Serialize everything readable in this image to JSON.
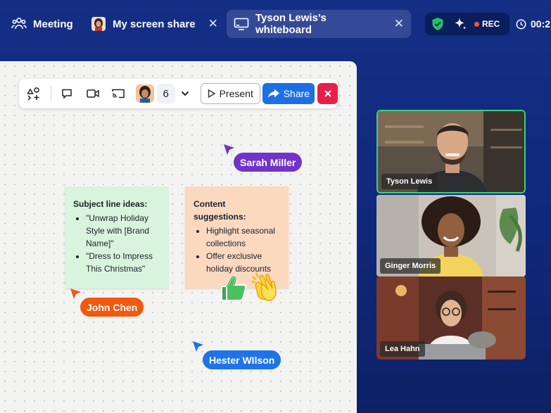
{
  "tabs": {
    "meeting": {
      "label": "Meeting",
      "icon": "people-icon"
    },
    "screen_share": {
      "label": "My screen share",
      "close": "✕"
    },
    "whiteboard": {
      "label": "Tyson Lewis’s whiteboard",
      "close": "✕",
      "active": true
    }
  },
  "status": {
    "rec_label": "REC",
    "timer": "00:2",
    "accent_green": "#22c36b"
  },
  "toolbar": {
    "participant_count": "6",
    "present_label": "Present",
    "share_label": "Share",
    "colors": {
      "share": "#1e6fe6",
      "stop": "#e5214a"
    }
  },
  "notes": [
    {
      "title": "Subject line ideas:",
      "items": [
        "\"Unwrap Holiday Style with [Brand Name]\"",
        "\"Dress to Impress This Christmas\""
      ],
      "color": "#d9f4dc"
    },
    {
      "title": "Content suggestions:",
      "items": [
        "Highlight seasonal collections",
        "Offer exclusive holiday discounts"
      ],
      "color": "#fbd9bf"
    }
  ],
  "cursors": [
    {
      "name": "Sarah Miller",
      "color": "#7233c9"
    },
    {
      "name": "John Chen",
      "color": "#f2580f"
    },
    {
      "name": "Hester WIlson",
      "color": "#1e73e8"
    }
  ],
  "reactions": [
    "thumbs-up-icon",
    "clapping-hands-icon"
  ],
  "participants": [
    {
      "name": "Tyson Lewis",
      "active_speaker": true
    },
    {
      "name": "Ginger Morris"
    },
    {
      "name": "Lea Hahn"
    }
  ]
}
